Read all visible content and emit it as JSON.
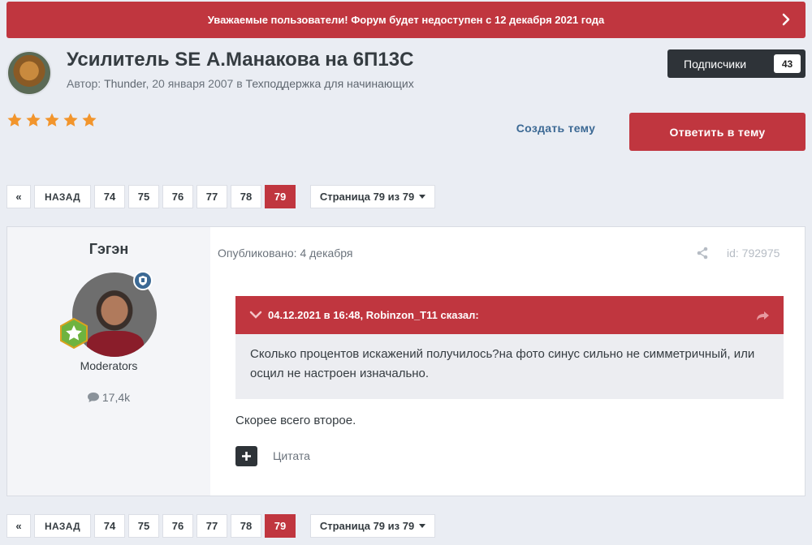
{
  "announcement": {
    "text": "Уважаемые пользователи! Форум будет недоступен с 12 декабря 2021 года",
    "icon": "chevron-right-icon"
  },
  "topic": {
    "title": "Усилитель SE А.Манакова на 6П13С",
    "meta_prefix": "Автор: ",
    "author": "Thunder",
    "meta_date": ", 20 января 2007 в ",
    "forum": "Техподдержка для начинающих",
    "rating_stars": 5
  },
  "follow": {
    "label": "Подписчики",
    "count": "43"
  },
  "actions": {
    "create_topic": "Создать тему",
    "reply": "Ответить в тему"
  },
  "pagination": {
    "first_icon": "«",
    "back": "НАЗАД",
    "pages": [
      "74",
      "75",
      "76",
      "77",
      "78",
      "79"
    ],
    "active": "79",
    "jump": "Страница 79 из 79"
  },
  "post": {
    "author_name": "Гэгэн",
    "author_group": "Moderators",
    "author_posts": "17,4k",
    "date": "Опубликовано: 4 декабря",
    "id": "id: 792975",
    "quote": {
      "header": "04.12.2021 в 16:48, Robinzon_T11 сказал:",
      "text": "Сколько процентов искажений получилось?на фото синус сильно не симметричный, или осцил не настроен изначально."
    },
    "body": "Скорее всего второе.",
    "quote_action": "Цитата"
  },
  "colors": {
    "accent": "#c0363f",
    "dark": "#2e3338",
    "link": "#3c6994",
    "star": "#f2952c",
    "background": "#eaedf3"
  }
}
